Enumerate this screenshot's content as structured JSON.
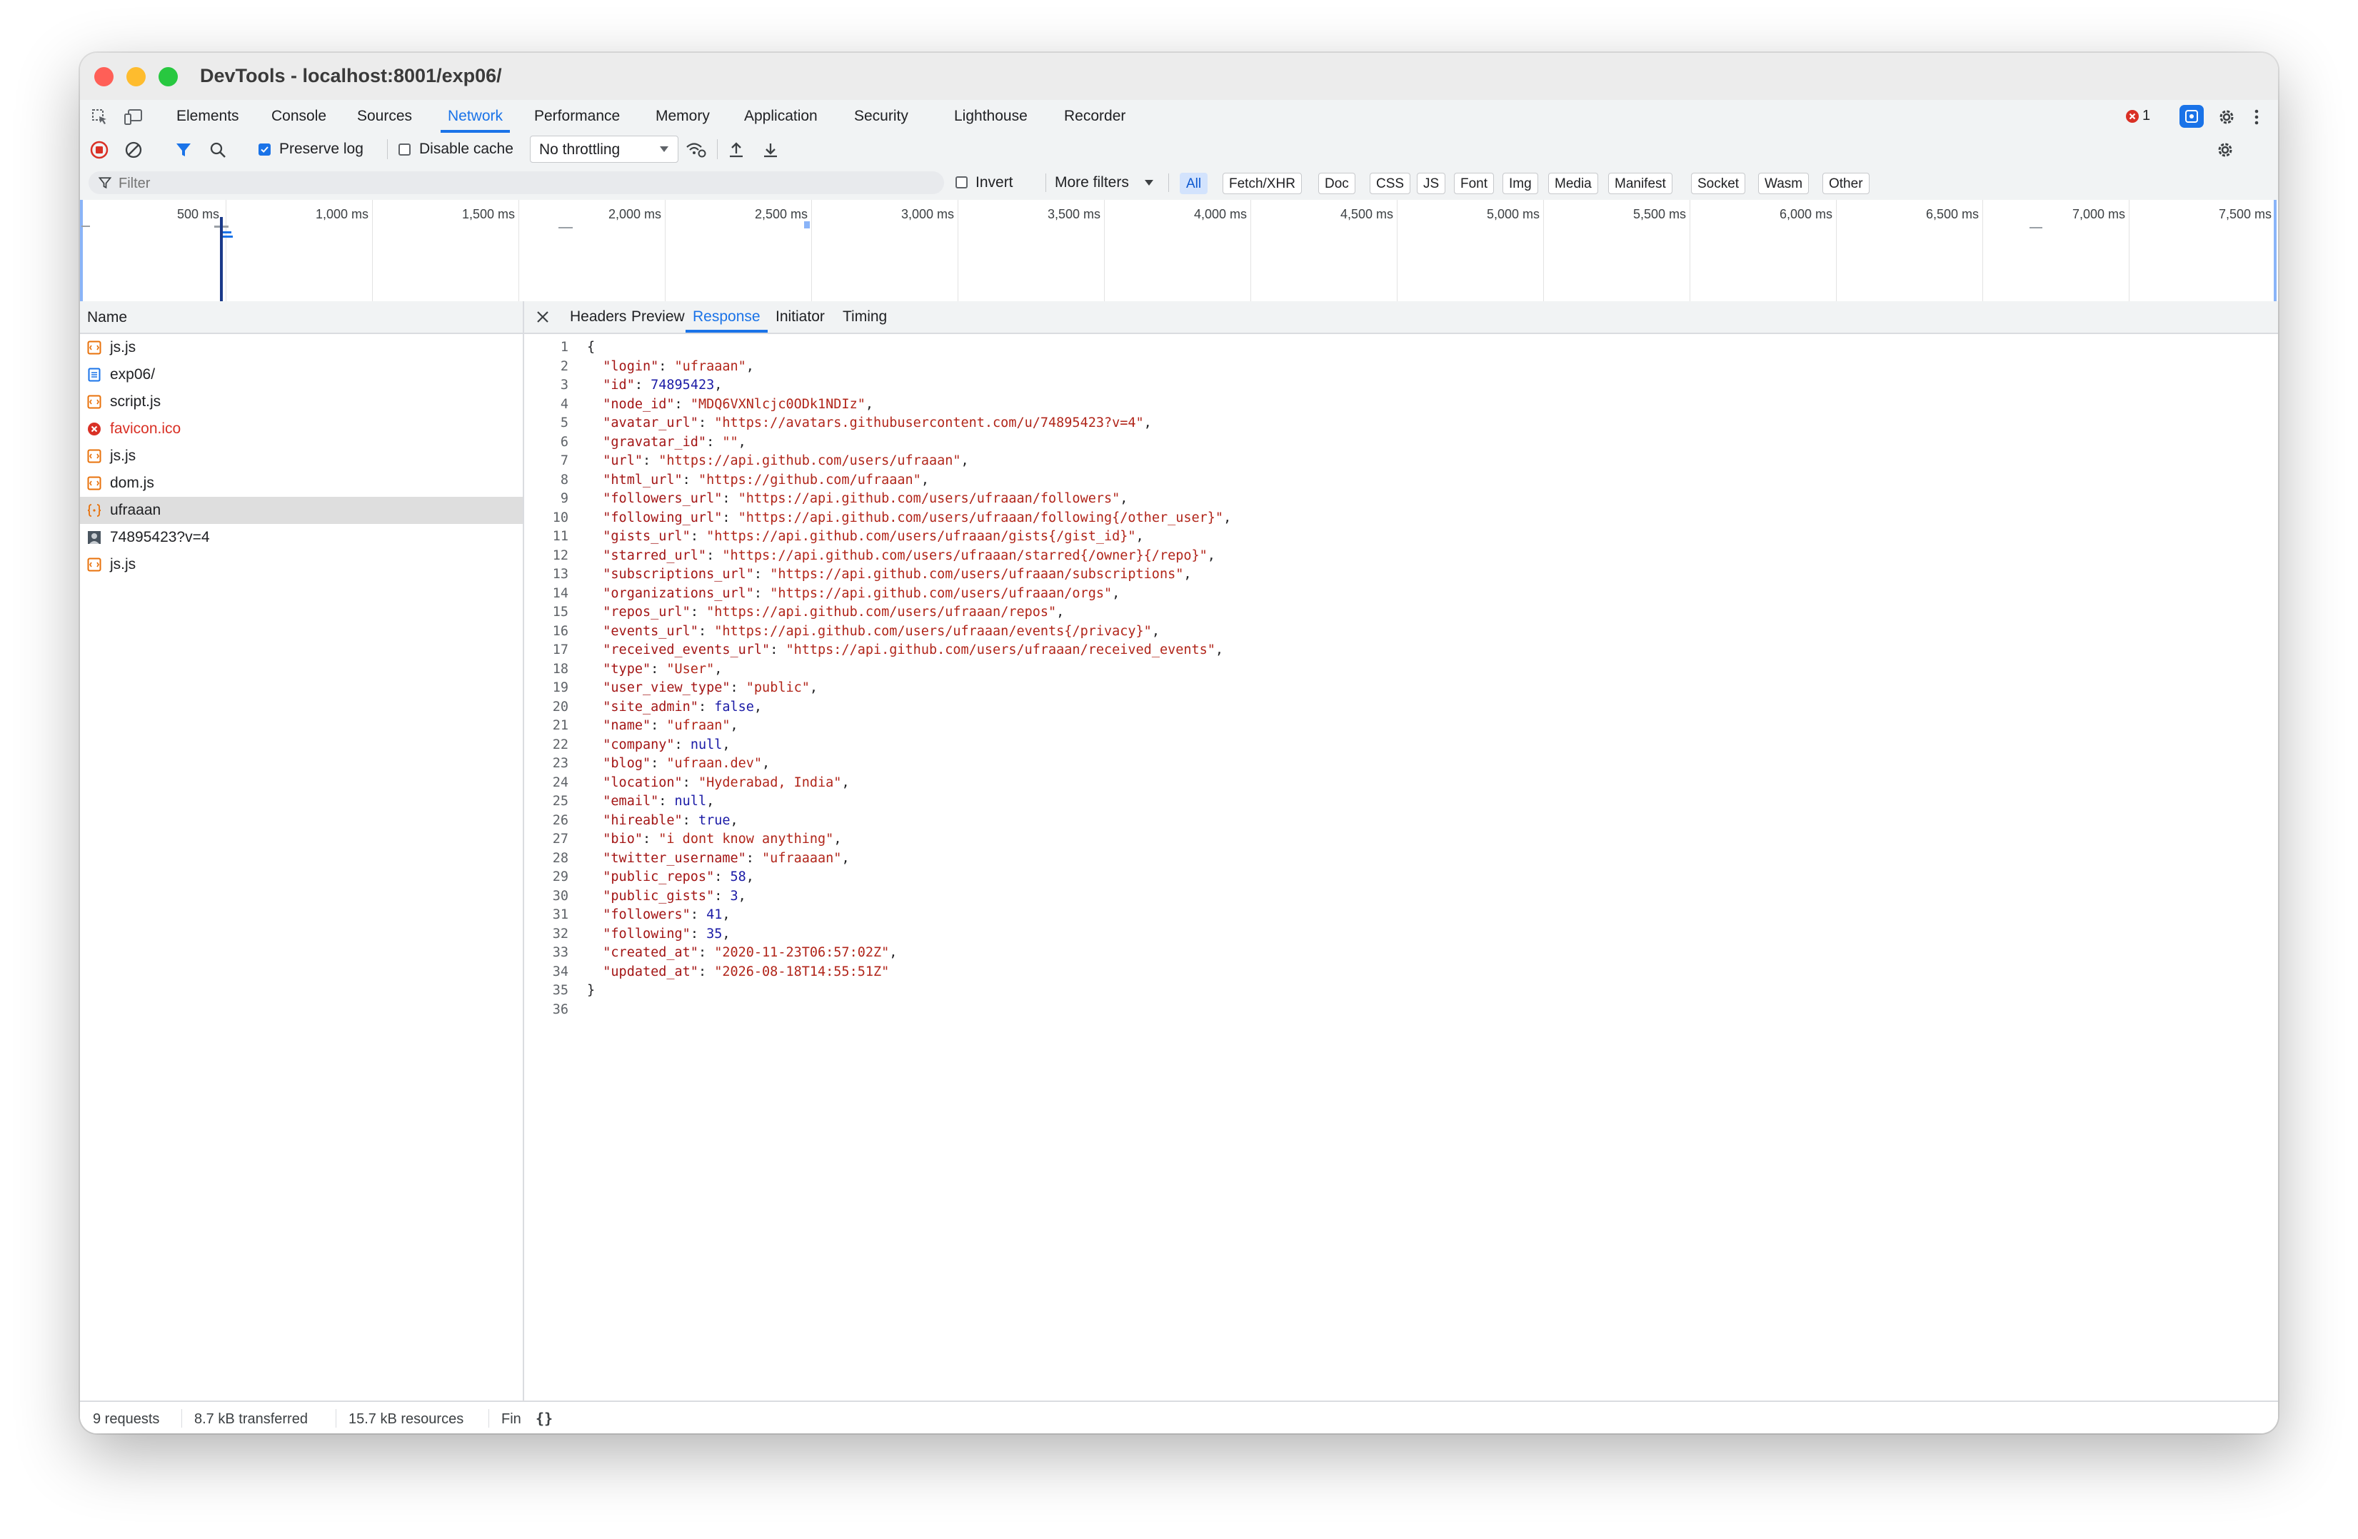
{
  "window": {
    "title": "DevTools - localhost:8001/exp06/"
  },
  "devtools_tabs": [
    "Elements",
    "Console",
    "Sources",
    "Network",
    "Performance",
    "Memory",
    "Application",
    "Security",
    "Lighthouse",
    "Recorder"
  ],
  "active_tab": "Network",
  "error_count": "1",
  "toolbar": {
    "preserve_log_label": "Preserve log",
    "preserve_log_checked": true,
    "disable_cache_label": "Disable cache",
    "disable_cache_checked": false,
    "throttling": "No throttling"
  },
  "filterbar": {
    "filter_placeholder": "Filter",
    "invert_label": "Invert",
    "more_filters_label": "More filters",
    "type_filters": [
      "All",
      "Fetch/XHR",
      "Doc",
      "CSS",
      "JS",
      "Font",
      "Img",
      "Media",
      "Manifest",
      "Socket",
      "Wasm",
      "Other"
    ],
    "selected_type": "All"
  },
  "timeline": {
    "ticks": [
      "500 ms",
      "1,000 ms",
      "1,500 ms",
      "2,000 ms",
      "2,500 ms",
      "3,000 ms",
      "3,500 ms",
      "4,000 ms",
      "4,500 ms",
      "5,000 ms",
      "5,500 ms",
      "6,000 ms",
      "6,500 ms",
      "7,000 ms",
      "7,500 ms"
    ]
  },
  "requests": {
    "column_name": "Name",
    "items": [
      {
        "name": "js.js",
        "type": "script",
        "error": false,
        "selected": false
      },
      {
        "name": "exp06/",
        "type": "document",
        "error": false,
        "selected": false
      },
      {
        "name": "script.js",
        "type": "script",
        "error": false,
        "selected": false
      },
      {
        "name": "favicon.ico",
        "type": "error",
        "error": true,
        "selected": false
      },
      {
        "name": "js.js",
        "type": "script",
        "error": false,
        "selected": false
      },
      {
        "name": "dom.js",
        "type": "script",
        "error": false,
        "selected": false
      },
      {
        "name": "ufraaan",
        "type": "fetch",
        "error": false,
        "selected": true
      },
      {
        "name": "74895423?v=4",
        "type": "image",
        "error": false,
        "selected": false
      },
      {
        "name": "js.js",
        "type": "script",
        "error": false,
        "selected": false
      }
    ]
  },
  "detail_tabs": [
    "Headers",
    "Preview",
    "Response",
    "Initiator",
    "Timing"
  ],
  "active_detail_tab": "Response",
  "response_lines": [
    {
      "t": "p",
      "text": "{"
    },
    {
      "t": "kv",
      "key": "\"login\"",
      "val": "\"ufraaan\"",
      "vt": "s",
      "end": ","
    },
    {
      "t": "kv",
      "key": "\"id\"",
      "val": "74895423",
      "vt": "n",
      "end": ","
    },
    {
      "t": "kv",
      "key": "\"node_id\"",
      "val": "\"MDQ6VXNlcjc0ODk1NDIz\"",
      "vt": "s",
      "end": ","
    },
    {
      "t": "kv",
      "key": "\"avatar_url\"",
      "val": "\"https://avatars.githubusercontent.com/u/74895423?v=4\"",
      "vt": "s",
      "end": ","
    },
    {
      "t": "kv",
      "key": "\"gravatar_id\"",
      "val": "\"\"",
      "vt": "s",
      "end": ","
    },
    {
      "t": "kv",
      "key": "\"url\"",
      "val": "\"https://api.github.com/users/ufraaan\"",
      "vt": "s",
      "end": ","
    },
    {
      "t": "kv",
      "key": "\"html_url\"",
      "val": "\"https://github.com/ufraaan\"",
      "vt": "s",
      "end": ","
    },
    {
      "t": "kv",
      "key": "\"followers_url\"",
      "val": "\"https://api.github.com/users/ufraaan/followers\"",
      "vt": "s",
      "end": ","
    },
    {
      "t": "kv",
      "key": "\"following_url\"",
      "val": "\"https://api.github.com/users/ufraaan/following{/other_user}\"",
      "vt": "s",
      "end": ","
    },
    {
      "t": "kv",
      "key": "\"gists_url\"",
      "val": "\"https://api.github.com/users/ufraaan/gists{/gist_id}\"",
      "vt": "s",
      "end": ","
    },
    {
      "t": "kv",
      "key": "\"starred_url\"",
      "val": "\"https://api.github.com/users/ufraaan/starred{/owner}{/repo}\"",
      "vt": "s",
      "end": ","
    },
    {
      "t": "kv",
      "key": "\"subscriptions_url\"",
      "val": "\"https://api.github.com/users/ufraaan/subscriptions\"",
      "vt": "s",
      "end": ","
    },
    {
      "t": "kv",
      "key": "\"organizations_url\"",
      "val": "\"https://api.github.com/users/ufraaan/orgs\"",
      "vt": "s",
      "end": ","
    },
    {
      "t": "kv",
      "key": "\"repos_url\"",
      "val": "\"https://api.github.com/users/ufraaan/repos\"",
      "vt": "s",
      "end": ","
    },
    {
      "t": "kv",
      "key": "\"events_url\"",
      "val": "\"https://api.github.com/users/ufraaan/events{/privacy}\"",
      "vt": "s",
      "end": ","
    },
    {
      "t": "kv",
      "key": "\"received_events_url\"",
      "val": "\"https://api.github.com/users/ufraaan/received_events\"",
      "vt": "s",
      "end": ","
    },
    {
      "t": "kv",
      "key": "\"type\"",
      "val": "\"User\"",
      "vt": "s",
      "end": ","
    },
    {
      "t": "kv",
      "key": "\"user_view_type\"",
      "val": "\"public\"",
      "vt": "s",
      "end": ","
    },
    {
      "t": "kv",
      "key": "\"site_admin\"",
      "val": "false",
      "vt": "n",
      "end": ","
    },
    {
      "t": "kv",
      "key": "\"name\"",
      "val": "\"ufraan\"",
      "vt": "s",
      "end": ","
    },
    {
      "t": "kv",
      "key": "\"company\"",
      "val": "null",
      "vt": "n",
      "end": ","
    },
    {
      "t": "kv",
      "key": "\"blog\"",
      "val": "\"ufraan.dev\"",
      "vt": "s",
      "end": ","
    },
    {
      "t": "kv",
      "key": "\"location\"",
      "val": "\"Hyderabad, India\"",
      "vt": "s",
      "end": ","
    },
    {
      "t": "kv",
      "key": "\"email\"",
      "val": "null",
      "vt": "n",
      "end": ","
    },
    {
      "t": "kv",
      "key": "\"hireable\"",
      "val": "true",
      "vt": "n",
      "end": ","
    },
    {
      "t": "kv",
      "key": "\"bio\"",
      "val": "\"i dont know anything\"",
      "vt": "s",
      "end": ","
    },
    {
      "t": "kv",
      "key": "\"twitter_username\"",
      "val": "\"ufraaaan\"",
      "vt": "s",
      "end": ","
    },
    {
      "t": "kv",
      "key": "\"public_repos\"",
      "val": "58",
      "vt": "n",
      "end": ","
    },
    {
      "t": "kv",
      "key": "\"public_gists\"",
      "val": "3",
      "vt": "n",
      "end": ","
    },
    {
      "t": "kv",
      "key": "\"followers\"",
      "val": "41",
      "vt": "n",
      "end": ","
    },
    {
      "t": "kv",
      "key": "\"following\"",
      "val": "35",
      "vt": "n",
      "end": ","
    },
    {
      "t": "kv",
      "key": "\"created_at\"",
      "val": "\"2020-11-23T06:57:02Z\"",
      "vt": "s",
      "end": ","
    },
    {
      "t": "kv",
      "key": "\"updated_at\"",
      "val": "\"2026-08-18T14:55:51Z\"",
      "vt": "s",
      "end": ""
    },
    {
      "t": "p",
      "text": "}"
    },
    {
      "t": "p",
      "text": ""
    }
  ],
  "status": {
    "requests": "9 requests",
    "transferred": "8.7 kB transferred",
    "resources": "15.7 kB resources",
    "finish": "Fin"
  },
  "colors": {
    "accent": "#1a73e8",
    "error": "#d93025",
    "string": "#b1251a",
    "number": "#1a1aa6"
  }
}
